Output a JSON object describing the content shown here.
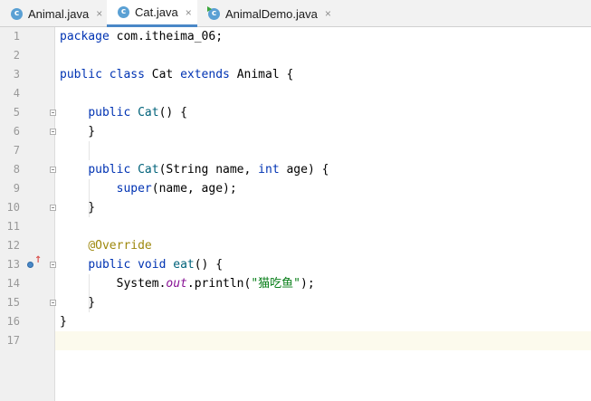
{
  "tabs": [
    {
      "label": "Animal.java",
      "icon": "class-icon",
      "active": false
    },
    {
      "label": "Cat.java",
      "icon": "class-icon",
      "active": true
    },
    {
      "label": "AnimalDemo.java",
      "icon": "runnable-class-icon",
      "active": false
    }
  ],
  "tab_icon_letter": "c",
  "close_glyph": "×",
  "line_numbers": [
    "1",
    "2",
    "3",
    "4",
    "5",
    "6",
    "7",
    "8",
    "9",
    "10",
    "11",
    "12",
    "13",
    "14",
    "15",
    "16",
    "17"
  ],
  "code": {
    "l1": [
      "package",
      " com.itheima_06;"
    ],
    "l3": [
      "public",
      " ",
      "class",
      " Cat ",
      "extends",
      " Animal {"
    ],
    "l5": [
      "    ",
      "public",
      " ",
      "Cat",
      "() {"
    ],
    "l6": [
      "    }"
    ],
    "l8": [
      "    ",
      "public",
      " ",
      "Cat",
      "(String name, ",
      "int",
      " age) {"
    ],
    "l9": [
      "        ",
      "super",
      "(name, age);"
    ],
    "l10": [
      "    }"
    ],
    "l12": [
      "    ",
      "@Override"
    ],
    "l13": [
      "    ",
      "public",
      " ",
      "void",
      " ",
      "eat",
      "() {"
    ],
    "l14": [
      "        System.",
      "out",
      ".println(",
      "\"猫吃鱼\"",
      ");"
    ],
    "l15": [
      "    }"
    ],
    "l16": [
      "}"
    ]
  },
  "colors": {
    "keyword": "#0033b3",
    "method": "#00627a",
    "annotation": "#9e880d",
    "static_field": "#871094",
    "string": "#067d17",
    "current_line": "#fcfaed"
  }
}
